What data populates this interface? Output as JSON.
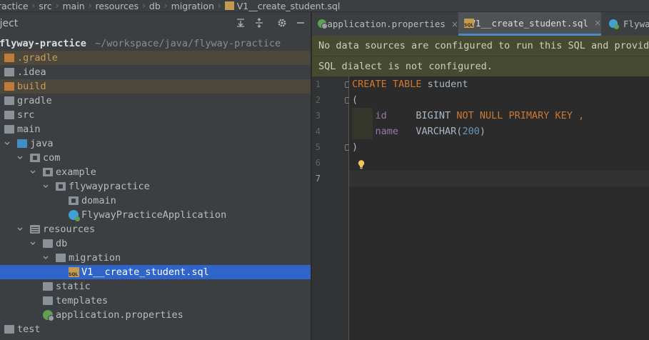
{
  "breadcrumb": [
    "ractice",
    "src",
    "main",
    "resources",
    "db",
    "migration",
    "V1__create_student.sql"
  ],
  "project_pane": {
    "title": "oject",
    "header_icons": [
      "collapse-all-icon",
      "expand-all-icon",
      "gear-icon",
      "minimize-icon"
    ]
  },
  "tree": [
    {
      "label": "flyway-practice",
      "path": "~/workspace/java/flyway-practice",
      "bold": true
    },
    {
      "label": ".gradle",
      "icon": "folder-orange",
      "excluded": true
    },
    {
      "label": ".idea",
      "icon": "folder"
    },
    {
      "label": "build",
      "icon": "folder-orange",
      "excluded": true
    },
    {
      "label": "gradle",
      "icon": "folder"
    },
    {
      "label": "src",
      "icon": "folder"
    },
    {
      "label": "main",
      "icon": "folder",
      "expanded": true
    },
    {
      "label": "java",
      "icon": "folder-blue",
      "expanded": true
    },
    {
      "label": "com",
      "icon": "package",
      "expanded": true
    },
    {
      "label": "example",
      "icon": "package",
      "expanded": true
    },
    {
      "label": "flywaypractice",
      "icon": "package",
      "expanded": true
    },
    {
      "label": "domain",
      "icon": "package"
    },
    {
      "label": "FlywayPracticeApplication",
      "icon": "class"
    },
    {
      "label": "resources",
      "icon": "resources",
      "expanded": true
    },
    {
      "label": "db",
      "icon": "folder",
      "expanded": true
    },
    {
      "label": "migration",
      "icon": "folder",
      "expanded": true
    },
    {
      "label": "V1__create_student.sql",
      "icon": "sql",
      "selected": true
    },
    {
      "label": "static",
      "icon": "folder"
    },
    {
      "label": "templates",
      "icon": "folder"
    },
    {
      "label": "application.properties",
      "icon": "spring"
    },
    {
      "label": "test",
      "icon": "folder"
    }
  ],
  "tabs": [
    {
      "label": "application.properties",
      "close": "×"
    },
    {
      "label": "V1__create_student.sql",
      "close": "×",
      "active": true
    },
    {
      "label": "Flyway"
    }
  ],
  "banners": {
    "no_data_source": "No data sources are configured to run this SQL and provide",
    "dialect": "SQL dialect is not configured."
  },
  "editor": {
    "line_numbers": [
      "1",
      "2",
      "3",
      "4",
      "5",
      "6",
      "7"
    ],
    "current_line": "7",
    "lines": [
      [
        {
          "t": "CREATE TABLE",
          "c": "kw"
        },
        {
          "t": " student",
          "c": "plain"
        }
      ],
      [
        {
          "t": "(",
          "c": "plain"
        }
      ],
      [
        {
          "t": "    ",
          "c": "plain"
        },
        {
          "t": "id",
          "c": "col"
        },
        {
          "t": "     BIGINT ",
          "c": "plain"
        },
        {
          "t": "NOT NULL PRIMARY KEY ,",
          "c": "kw"
        }
      ],
      [
        {
          "t": "    ",
          "c": "plain"
        },
        {
          "t": "name",
          "c": "col"
        },
        {
          "t": "   VARCHAR(",
          "c": "plain"
        },
        {
          "t": "200",
          "c": "num"
        },
        {
          "t": ")",
          "c": "plain"
        }
      ],
      [
        {
          "t": ")",
          "c": "plain"
        }
      ],
      [],
      []
    ]
  },
  "colors": {
    "keyword": "#cc7832",
    "selection": "#2f65ca",
    "banner_bg": "#464a31"
  }
}
